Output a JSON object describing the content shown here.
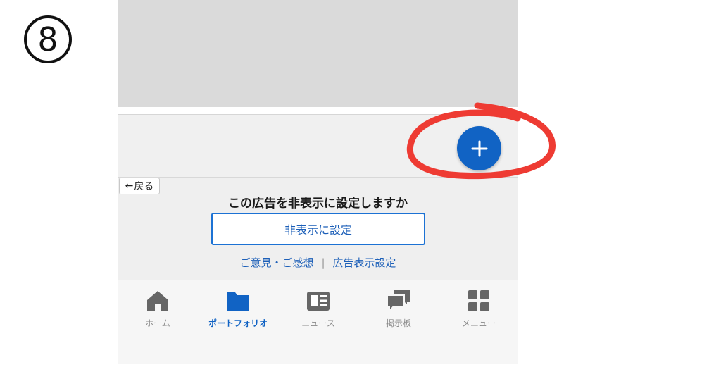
{
  "step": {
    "number": "8"
  },
  "fab": {
    "icon": "plus-icon",
    "color": "#1163c4"
  },
  "ad": {
    "back_label": "戻る",
    "question": "この広告を非表示に設定しますか",
    "hide_button_label": "非表示に設定",
    "feedback_link": "ご意見・ご感想",
    "separator": "|",
    "ad_settings_link": "広告表示設定"
  },
  "tabbar": {
    "active_color": "#1163c4",
    "inactive_color": "#666666",
    "items": [
      {
        "label": "ホーム",
        "icon": "home-icon",
        "active": false
      },
      {
        "label": "ポートフォリオ",
        "icon": "folder-icon",
        "active": true
      },
      {
        "label": "ニュース",
        "icon": "newspaper-icon",
        "active": false
      },
      {
        "label": "掲示板",
        "icon": "chat-bubbles-icon",
        "active": false
      },
      {
        "label": "メニュー",
        "icon": "grid-menu-icon",
        "active": false
      }
    ]
  },
  "annotation": {
    "color": "#ee3b33",
    "shape": "hand-drawn-circle"
  }
}
